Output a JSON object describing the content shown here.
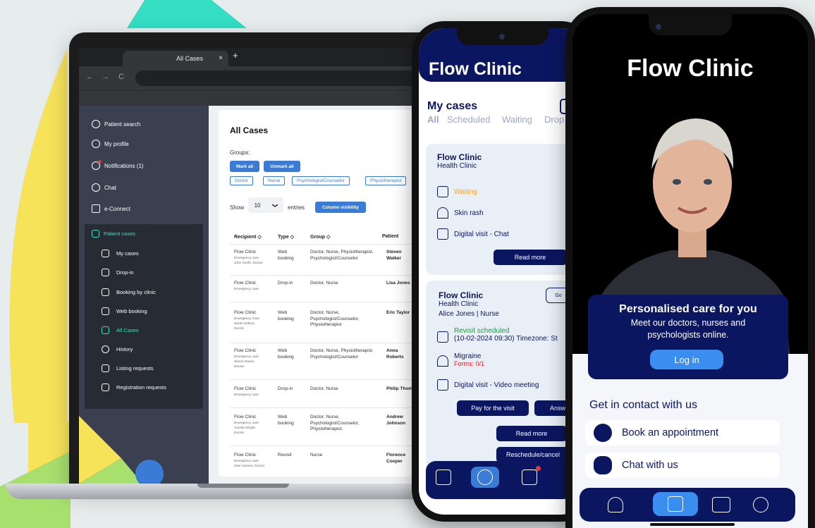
{
  "browser": {
    "tab_title": "All Cases",
    "tab_close": "×",
    "new_tab": "+",
    "back": "←",
    "forward": "→",
    "reload": "C"
  },
  "sidebar": {
    "items": [
      {
        "label": "Patient search"
      },
      {
        "label": "My profile"
      },
      {
        "label": "Notifications (1)"
      },
      {
        "label": "Chat"
      },
      {
        "label": "e-Connect"
      }
    ],
    "patient_cases": {
      "label": "Patient cases",
      "items": [
        {
          "label": "My cases"
        },
        {
          "label": "Drop-in"
        },
        {
          "label": "Booking by clinic"
        },
        {
          "label": "Web booking"
        },
        {
          "label": "All Cases"
        },
        {
          "label": "History"
        },
        {
          "label": "Listing requests"
        },
        {
          "label": "Registration requests"
        }
      ]
    },
    "collapse_icon": "‹"
  },
  "main": {
    "title": "All Cases",
    "groups_label": "Groups:",
    "mark_all": "Mark all",
    "unmark_all": "Unmark all",
    "chips": [
      "Doctor",
      "Nurse",
      "Psychologist/Counselor",
      "Physiotherapist"
    ],
    "show": "Show",
    "entries_value": "10",
    "entries_caret": "❯",
    "entries": "entries",
    "column_visibility": "Column visibility",
    "columns": [
      "Recipient ◇",
      "Type ◇",
      "Group ◇",
      "Patient"
    ],
    "rows": [
      {
        "clinic": "Flow Clinic",
        "sub1": "Emergency care",
        "sub2": "John Smith, Doctor",
        "sub3": "",
        "type": "Web booking",
        "group": "Doctor, Nurse, Physiotherapist, Psychologist/Counselor",
        "patient": "Steven Walker"
      },
      {
        "clinic": "Flow Clinic",
        "sub1": "Emergency care",
        "sub2": "",
        "sub3": "",
        "type": "Drop-in",
        "group": "Doctor, Nurse",
        "patient": "Lisa Jones"
      },
      {
        "clinic": "Flow Clinic",
        "sub1": "Emergency Care",
        "sub2": "Sarah Wilson,",
        "sub3": "Doctor",
        "type": "Web booking",
        "group": "Doctor, Nurse, Psychologist/Counselor, Physiotherapist",
        "patient": "Eric Taylor"
      },
      {
        "clinic": "Flow Clinic",
        "sub1": "Emergency care",
        "sub2": "Simon Green,",
        "sub3": "Doctor",
        "type": "Web booking",
        "group": "Doctor, Nurse, Physiotherapist, Psychologist/Counselor",
        "patient": "Anna Roberts"
      },
      {
        "clinic": "Flow Clinic",
        "sub1": "Emergency care",
        "sub2": "",
        "sub3": "",
        "type": "Drop-in",
        "group": "Doctor, Nurse",
        "patient": "Philip Thompson"
      },
      {
        "clinic": "Flow Clinic",
        "sub1": "Emergency care",
        "sub2": "Amelia Wright,",
        "sub3": "Doctor",
        "type": "Web booking",
        "group": "Doctor, Nurse, Psychologist/Counselor, Physiotherapist.",
        "patient": "Andrew Johnson"
      },
      {
        "clinic": "Flow Clinic",
        "sub1": "Emergency care",
        "sub2": "Alan Harries, Doctor",
        "sub3": "",
        "type": "Revisit",
        "group": "Nurse",
        "patient": "Florence Cooper"
      }
    ]
  },
  "phone1": {
    "brand": "Flow Clinic",
    "heading": "My cases",
    "tabs": [
      "All",
      "Scheduled",
      "Waiting",
      "Drop"
    ],
    "case1": {
      "clinic": "Flow Clinic",
      "sub": "Health Clinic",
      "status": "Waiting",
      "reason": "Skin rash",
      "visit": "Digital visit - Chat",
      "read_more": "Read more"
    },
    "case2": {
      "clinic": "Flow Clinic",
      "sub": "Health Clinic",
      "staff": "Alice Jones | Nurse",
      "status": "Revisit scheduled",
      "datetime": "(10-02-2024  09:30) Timezone: St",
      "reason": "Migraine",
      "forms": "Forms: 0/1",
      "visit": "Digital visit - Video meeting",
      "pay": "Pay for the visit",
      "answer": "Answ",
      "go": "Go",
      "read_more": "Read more",
      "reschedule": "Reschedule/cancel"
    }
  },
  "phone2": {
    "brand": "Flow Clinic",
    "tagline": "Personalised care for you",
    "subtitle": "Meet our doctors, nurses and psychologists online.",
    "login": "Log in",
    "contact_heading": "Get in contact with us",
    "book": "Book an appointment",
    "chat": "Chat with us"
  },
  "colors": {
    "navy": "#0b1660",
    "accent_blue": "#3a7bd5",
    "teal": "#3ee0c5",
    "waiting": "#f5a623",
    "revisit": "#1a9c3c",
    "forms": "#e02020"
  }
}
